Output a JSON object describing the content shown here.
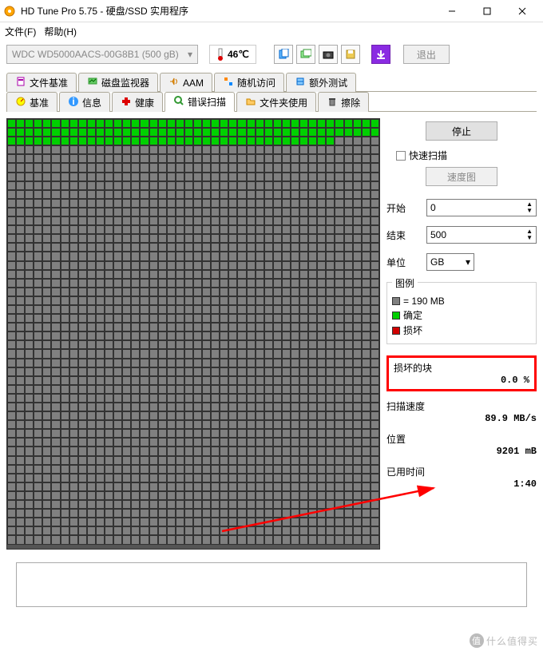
{
  "title": "HD Tune Pro 5.75 - 硬盘/SSD 实用程序",
  "menu": {
    "file": "文件(F)",
    "help": "帮助(H)"
  },
  "drive": "WDC WD5000AACS-00G8B1 (500 gB)",
  "temp": "46℃",
  "exit": "退出",
  "tabs_top": [
    {
      "icon": "file-bench-icon",
      "label": "文件基准"
    },
    {
      "icon": "disk-monitor-icon",
      "label": "磁盘监视器"
    },
    {
      "icon": "aam-icon",
      "label": "AAM"
    },
    {
      "icon": "random-icon",
      "label": "随机访问"
    },
    {
      "icon": "extra-test-icon",
      "label": "额外测试"
    }
  ],
  "tabs_bottom": [
    {
      "icon": "bench-icon",
      "label": "基准"
    },
    {
      "icon": "info-icon",
      "label": "信息"
    },
    {
      "icon": "health-icon",
      "label": "健康"
    },
    {
      "icon": "error-scan-icon",
      "label": "错误扫描",
      "active": true
    },
    {
      "icon": "folder-usage-icon",
      "label": "文件夹使用"
    },
    {
      "icon": "erase-icon",
      "label": "擦除"
    }
  ],
  "side": {
    "stop": "停止",
    "quick_scan": "快速扫描",
    "speed_map": "速度图",
    "start_lbl": "开始",
    "start_val": "0",
    "end_lbl": "结束",
    "end_val": "500",
    "unit_lbl": "单位",
    "unit_val": "GB"
  },
  "legend": {
    "title": "图例",
    "block_size": "= 190 MB",
    "ok": "确定",
    "bad": "损坏"
  },
  "stats": {
    "damaged_title": "损坏的块",
    "damaged_val": "0.0 %",
    "speed_title": "扫描速度",
    "speed_val": "89.9 MB/s",
    "pos_title": "位置",
    "pos_val": "9201 mB",
    "time_title": "已用时间",
    "time_val": "1:40"
  },
  "grid": {
    "cols": 42,
    "rows": 48,
    "green_rows": 2,
    "green_extra": 37
  },
  "watermark": "什么值得买"
}
